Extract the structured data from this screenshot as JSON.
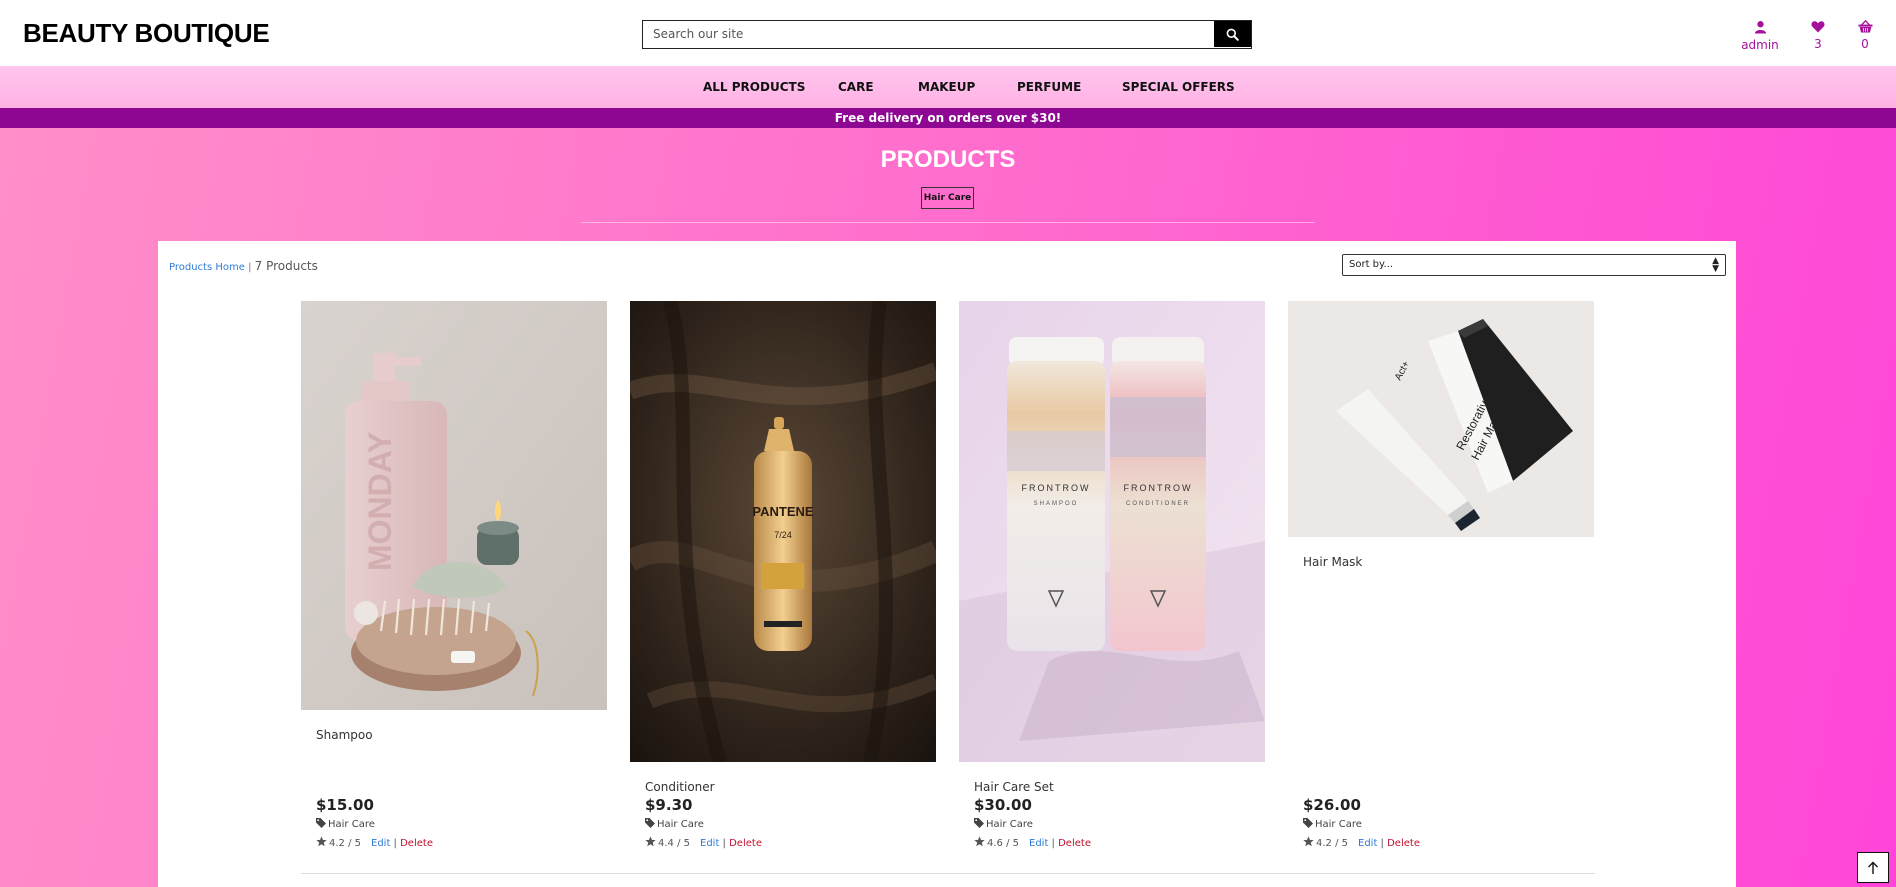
{
  "header": {
    "brand": "BEAUTY BOUTIQUE",
    "search_placeholder": "Search our site",
    "account_label": "admin",
    "wishlist_count": "3",
    "cart_count": "0"
  },
  "nav": {
    "items": [
      {
        "label": "ALL PRODUCTS"
      },
      {
        "label": "CARE"
      },
      {
        "label": "MAKEUP"
      },
      {
        "label": "PERFUME"
      },
      {
        "label": "SPECIAL OFFERS"
      }
    ]
  },
  "banner": {
    "text": "Free delivery on orders over $30!"
  },
  "page": {
    "title": "PRODUCTS",
    "category_chip": "Hair Care",
    "breadcrumb_link": "Products Home",
    "separator": " | ",
    "product_count": "7 Products",
    "sort_label": "Sort by..."
  },
  "products": [
    {
      "name": "Shampoo",
      "price": "$15.00",
      "category": "Hair Care",
      "rating": "4.2 / 5",
      "edit": "Edit",
      "sep": " | ",
      "delete": "Delete"
    },
    {
      "name": "Conditioner",
      "price": "$9.30",
      "category": "Hair Care",
      "rating": "4.4 / 5",
      "edit": "Edit",
      "sep": " | ",
      "delete": "Delete"
    },
    {
      "name": "Hair Care Set",
      "price": "$30.00",
      "category": "Hair Care",
      "rating": "4.6 / 5",
      "edit": "Edit",
      "sep": " | ",
      "delete": "Delete"
    },
    {
      "name": "Hair Mask",
      "price": "$26.00",
      "category": "Hair Care",
      "rating": "4.2 / 5",
      "edit": "Edit",
      "sep": " | ",
      "delete": "Delete"
    }
  ],
  "colors": {
    "accent": "#a5119a",
    "banner": "#8e0792",
    "link": "#2f7bd6",
    "delete": "#c0102c"
  }
}
